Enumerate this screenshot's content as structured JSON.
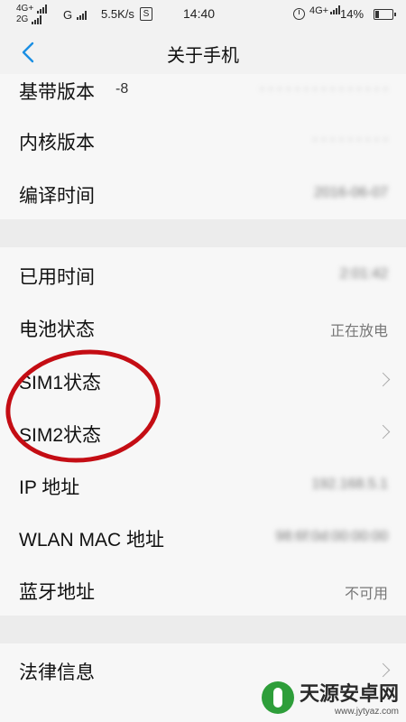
{
  "status_bar": {
    "net1_top": "4G+",
    "net1_bottom": "2G",
    "net2": "G",
    "speed": "5.5K/s",
    "s_icon": "S",
    "time": "14:40",
    "net3": "4G+",
    "battery": "14%"
  },
  "header": {
    "title": "关于手机",
    "back_icon": "chevron-left-icon",
    "accent": "#1a8fe3"
  },
  "items": [
    {
      "label": "基带版本",
      "value": "-8"
    },
    {
      "label": "内核版本",
      "value": ""
    },
    {
      "label": "编译时间",
      "value": "2016-06-07"
    },
    {
      "label": "已用时间",
      "value": "2:01:42"
    },
    {
      "label": "电池状态",
      "value": "正在放电"
    },
    {
      "label": "SIM1状态",
      "value": ""
    },
    {
      "label": "SIM2状态",
      "value": ""
    },
    {
      "label": "IP 地址",
      "value": "192.168.5.1"
    },
    {
      "label": "WLAN MAC 地址",
      "value": "98:6f:0d:00:00:00"
    },
    {
      "label": "蓝牙地址",
      "value": "不可用"
    },
    {
      "label": "法律信息",
      "value": ""
    }
  ],
  "watermark": {
    "name": "天源安卓网",
    "url": "www.jytyaz.com",
    "color": "#2e9e3a"
  },
  "annotation_color": "#c40d14"
}
